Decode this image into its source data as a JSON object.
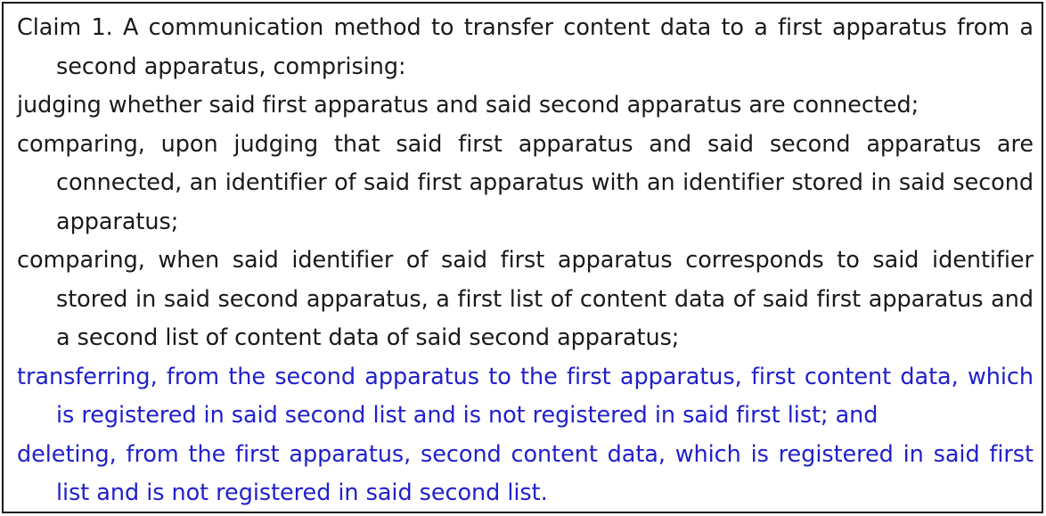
{
  "document": {
    "type": "patent-claim-text-box",
    "border_color": "#1a1a1a",
    "background_color": "#ffffff",
    "body_text_color": "#1a1a1a",
    "amended_text_color": "#2020cc",
    "paragraphs": [
      {
        "id": "preamble",
        "color": "black",
        "text": "Claim 1. A communication method to transfer content data to a first apparatus from a second apparatus, comprising:"
      },
      {
        "id": "step-judging",
        "color": "black",
        "text": "judging whether said first apparatus and said second apparatus are connected;"
      },
      {
        "id": "step-comparing-identifier",
        "color": "black",
        "text": "comparing, upon judging that said first apparatus and said second apparatus are connected, an identifier of said first apparatus with an identifier stored in said second apparatus;"
      },
      {
        "id": "step-comparing-lists",
        "color": "black",
        "text": "comparing, when said identifier of said first apparatus corresponds to said identifier stored in said second apparatus, a first list of content data of said first apparatus and a second list of content data of said second apparatus;"
      },
      {
        "id": "step-transferring",
        "color": "blue",
        "text": "transferring, from the second apparatus to the first apparatus, first content data, which is registered in said second list and is not registered in said first list; and"
      },
      {
        "id": "step-deleting",
        "color": "blue",
        "text": "deleting, from the first apparatus, second content data, which is registered in said first list and is not registered in said second list."
      }
    ]
  }
}
